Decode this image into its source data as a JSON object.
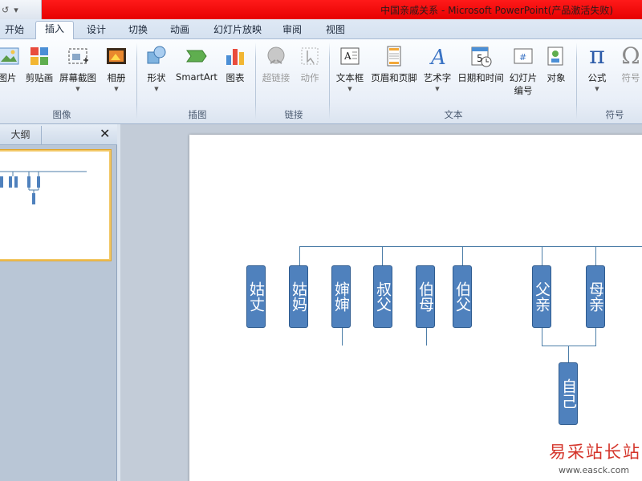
{
  "window": {
    "title": "中国亲戚关系 - Microsoft PowerPoint(产品激活失败)",
    "qat": {
      "undo": "↺",
      "customize": "▾"
    }
  },
  "tabs": [
    {
      "label": "开始"
    },
    {
      "label": "插入",
      "active": true
    },
    {
      "label": "设计"
    },
    {
      "label": "切换"
    },
    {
      "label": "动画"
    },
    {
      "label": "幻灯片放映"
    },
    {
      "label": "审阅"
    },
    {
      "label": "视图"
    }
  ],
  "ribbon": {
    "groups": {
      "image": "图像",
      "illustrations": "插图",
      "links": "链接",
      "text": "文本",
      "symbols": "符号"
    },
    "buttons": {
      "picture": "图片",
      "clipart": "剪贴画",
      "screenshot": "屏幕截图",
      "album": "相册",
      "shapes": "形状",
      "smartart": "SmartArt",
      "chart": "图表",
      "hyperlink": "超链接",
      "action": "动作",
      "textbox": "文本框",
      "header_footer": "页眉和页脚",
      "wordart": "艺术字",
      "datetime": "日期和时间",
      "slide_number_1": "幻灯片",
      "slide_number_2": "编号",
      "object": "对象",
      "equation": "公式",
      "symbol": "符号"
    },
    "icons": {
      "equation_glyph": "π",
      "symbol_glyph": "Ω",
      "wordart_glyph": "A",
      "datetime_glyph": "5"
    }
  },
  "left_panel": {
    "tab_outline": "大纲",
    "close": "✕"
  },
  "slide": {
    "nodes": {
      "guzhang": "姑丈",
      "guma": "姑妈",
      "shenshen": "婶婶",
      "shufu": "叔父",
      "bomu": "伯母",
      "bofu": "伯父",
      "fuqin": "父亲",
      "muqin": "母亲",
      "ziji": "自己"
    },
    "node_color": "#4f81bd"
  },
  "watermark": {
    "text": "易采站长站",
    "url": "www.easck.com"
  }
}
